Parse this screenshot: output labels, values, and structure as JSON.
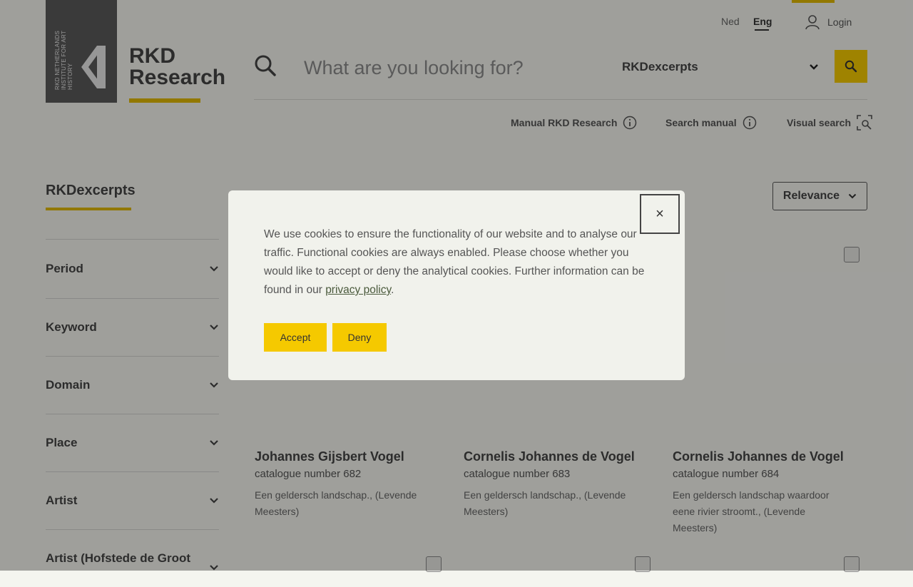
{
  "brand": {
    "vertical_text": "RKD NETHERLANDS INSTITUTE FOR ART HISTORY",
    "title_line1": "RKD",
    "title_line2": "Research",
    "accent_color": "#e0b800"
  },
  "header": {
    "lang_ned": "Ned",
    "lang_eng": "Eng",
    "login_label": "Login"
  },
  "search": {
    "placeholder": "What are you looking for?",
    "database": "RKDexcerpts"
  },
  "help_links": {
    "manual": "Manual RKD Research",
    "search_manual": "Search manual",
    "visual_search": "Visual search"
  },
  "sidebar": {
    "title": "RKDexcerpts",
    "facets": [
      "Period",
      "Keyword",
      "Domain",
      "Place",
      "Artist",
      "Artist (Hofstede de Groot"
    ]
  },
  "sort": {
    "label": "Relevance"
  },
  "results": [
    {
      "title": "Johannes Gijsbert Vogel",
      "catalogue": "catalogue number 682",
      "desc": "Een geldersch landschap., (Levende Meesters)"
    },
    {
      "title": "Cornelis Johannes de Vogel",
      "catalogue": "catalogue number 683",
      "desc": "Een geldersch landschap., (Levende Meesters)"
    },
    {
      "title": "Cornelis Johannes de Vogel",
      "catalogue": "catalogue number 684",
      "desc": "Een geldersch landschap waardoor eene rivier stroomt., (Levende Meesters)"
    }
  ],
  "cookie": {
    "text": "We use cookies to ensure the functionality of our website and to analyse our traffic. Functional cookies are always enabled. Please choose whether you would like to accept or deny the analytical cookies. Further information can be found in our ",
    "link": "privacy policy",
    "period": ".",
    "close": "×",
    "accept": "Accept",
    "deny": "Deny"
  }
}
